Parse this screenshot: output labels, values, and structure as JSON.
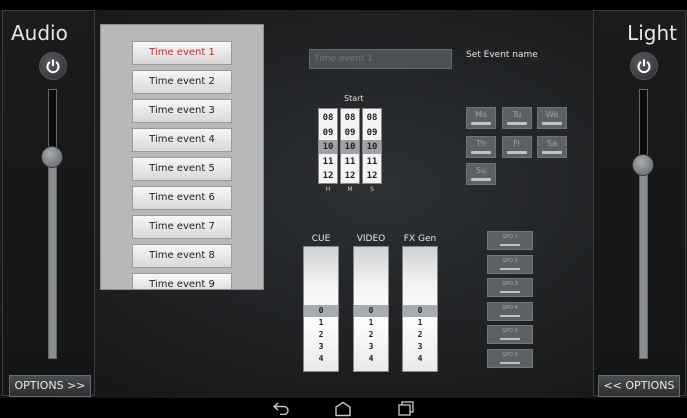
{
  "audio_panel": {
    "title": "Audio",
    "options_label": "OPTIONS >>",
    "slider_value": 0.75
  },
  "light_panel": {
    "title": "Light",
    "options_label": "<< OPTIONS",
    "slider_value": 0.72
  },
  "event_list": {
    "items": [
      "Time event 1",
      "Time event 2",
      "Time event 3",
      "Time event 4",
      "Time event 5",
      "Time event 6",
      "Time event 7",
      "Time event 8",
      "Time event 9"
    ],
    "selected_index": 0,
    "selected_color": "#e02020"
  },
  "event_name": {
    "placeholder": "Time event 1",
    "label": "Set Event name"
  },
  "start": {
    "label": "Start",
    "columns": [
      {
        "label": "H",
        "values": [
          "08",
          "09",
          "10",
          "11",
          "12"
        ],
        "selected": "10"
      },
      {
        "label": "M",
        "values": [
          "08",
          "09",
          "10",
          "11",
          "12"
        ],
        "selected": "10"
      },
      {
        "label": "S",
        "values": [
          "08",
          "09",
          "10",
          "11",
          "12"
        ],
        "selected": "10"
      }
    ]
  },
  "days": [
    "Mo",
    "Tu",
    "We",
    "Th",
    "Fr",
    "Sa",
    "Su"
  ],
  "wheels": [
    {
      "label": "CUE",
      "values": [
        "0",
        "1",
        "2",
        "3",
        "4"
      ],
      "selected": "0"
    },
    {
      "label": "VIDEO",
      "values": [
        "0",
        "1",
        "2",
        "3",
        "4"
      ],
      "selected": "0"
    },
    {
      "label": "FX Gen",
      "values": [
        "0",
        "1",
        "2",
        "3",
        "4"
      ],
      "selected": "0"
    }
  ],
  "gpo": [
    "GPO 1",
    "GPO 2",
    "GPO 3",
    "GPO 4",
    "GPO 5",
    "GPO 6"
  ],
  "navbar": {
    "icons": [
      "back-icon",
      "home-icon",
      "recent-apps-icon"
    ]
  }
}
